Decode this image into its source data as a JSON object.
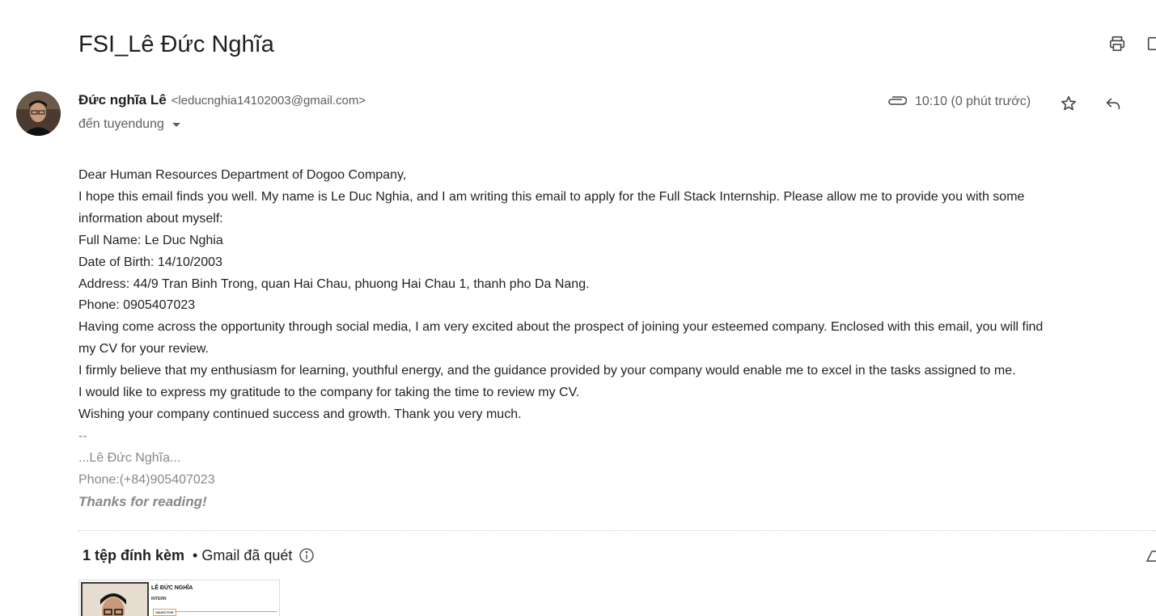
{
  "email": {
    "subject": "FSI_Lê Đức Nghĩa",
    "sender_name": "Đức nghĩa Lê",
    "sender_email": "<leducnghia14102003@gmail.com>",
    "to_label": "đến tuyendung",
    "time": "10:10 (0 phút trước)"
  },
  "body": {
    "lines": [
      "Dear Human Resources Department of Dogoo Company,",
      "I hope this email finds you well. My name is Le Duc Nghia, and I am writing this email to apply for the Full Stack Internship. Please allow me to provide you with some",
      "information about myself:",
      "Full Name: Le Duc Nghia",
      "Date of Birth: 14/10/2003",
      "Address: 44/9 Tran Binh Trong, quan Hai Chau, phuong Hai Chau 1, thanh pho Da Nang.",
      "Phone: 0905407023",
      "Having come across the opportunity through social media, I am very excited about the prospect of joining your esteemed company. Enclosed with this email, you will find",
      "my CV for your review.",
      "I firmly believe that my enthusiasm for learning, youthful energy, and the guidance provided by your company would enable me to excel in the tasks assigned to me.",
      "I would like to express my gratitude to the company for taking the time to review my CV.",
      "Wishing your company continued success and growth. Thank you very much."
    ],
    "signature": {
      "separator": "--",
      "name": "...Lê Đức Nghĩa...",
      "phone": "Phone:(+84)905407023",
      "thanks": "Thanks for reading!"
    }
  },
  "attachments": {
    "count_label": "1 tệp đính kèm",
    "scan_label": "• Gmail đã quét",
    "thumbnail": {
      "name": "LÊ ĐỨC NGHĨA",
      "role": "INTERN",
      "section": "OBJECTIVE"
    }
  },
  "icons": {
    "print": "print-icon",
    "open_new_window": "open-in-new-window-icon",
    "attachment": "paperclip-icon",
    "star": "star-icon",
    "reply": "reply-icon",
    "info": "info-icon",
    "drive": "drive-icon"
  },
  "colors": {
    "text_primary": "#1f1f1f",
    "text_secondary": "#5e5e5e",
    "body_text": "#222222",
    "signature": "#888888"
  }
}
